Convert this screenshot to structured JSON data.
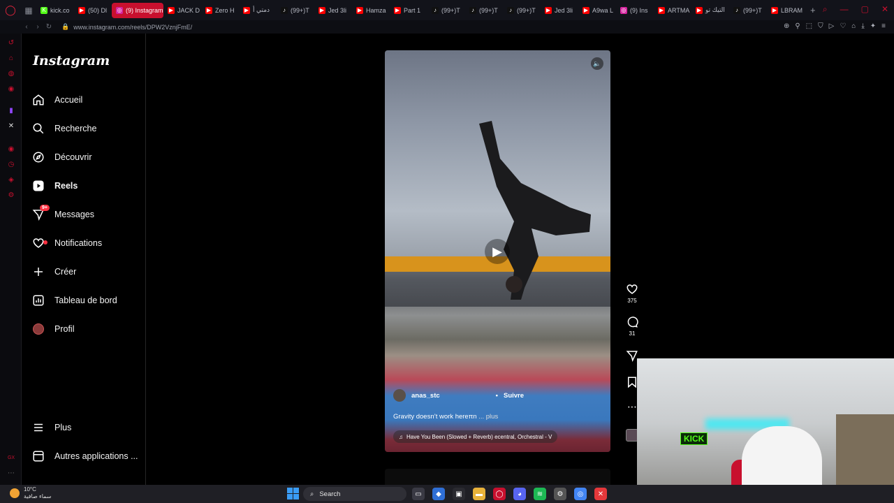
{
  "browser": {
    "tabs": [
      {
        "label": "kick.co",
        "favicon_color": "#53fc18",
        "favicon_glyph": "K"
      },
      {
        "label": "(50) Dl",
        "favicon_color": "#ff0000",
        "favicon_glyph": "▶"
      },
      {
        "label": "(9) Instagram",
        "favicon_color": "#d6249f",
        "favicon_glyph": "◎",
        "active": true
      },
      {
        "label": "JACK D",
        "favicon_color": "#ff0000",
        "favicon_glyph": "▶"
      },
      {
        "label": "Zero H",
        "favicon_color": "#ff0000",
        "favicon_glyph": "▶"
      },
      {
        "label": "دمتي أ",
        "favicon_color": "#ff0000",
        "favicon_glyph": "▶"
      },
      {
        "label": "(99+)T",
        "favicon_color": "#111111",
        "favicon_glyph": "♪"
      },
      {
        "label": "Jed 3li",
        "favicon_color": "#ff0000",
        "favicon_glyph": "▶"
      },
      {
        "label": "Hamza",
        "favicon_color": "#ff0000",
        "favicon_glyph": "▶"
      },
      {
        "label": "Part 1",
        "favicon_color": "#ff0000",
        "favicon_glyph": "▶"
      },
      {
        "label": "(99+)T",
        "favicon_color": "#111111",
        "favicon_glyph": "♪"
      },
      {
        "label": "(99+)T",
        "favicon_color": "#111111",
        "favicon_glyph": "♪"
      },
      {
        "label": "(99+)T",
        "favicon_color": "#111111",
        "favicon_glyph": "♪"
      },
      {
        "label": "Jed 3li",
        "favicon_color": "#ff0000",
        "favicon_glyph": "▶"
      },
      {
        "label": "A9wa L",
        "favicon_color": "#ff0000",
        "favicon_glyph": "▶"
      },
      {
        "label": "(9) Ins",
        "favicon_color": "#d6249f",
        "favicon_glyph": "◎"
      },
      {
        "label": "ARTMA",
        "favicon_color": "#ff0000",
        "favicon_glyph": "▶"
      },
      {
        "label": "التيك تو",
        "favicon_color": "#ff0000",
        "favicon_glyph": "▶"
      },
      {
        "label": "(99+)T",
        "favicon_color": "#111111",
        "favicon_glyph": "♪"
      },
      {
        "label": "LBRAM",
        "favicon_color": "#ff0000",
        "favicon_glyph": "▶"
      }
    ],
    "new_tab_glyph": "+",
    "url": "www.instagram.com/reels/DPW2VznjFmE/",
    "accent": "#c8102e"
  },
  "instagram": {
    "logo": "Instagram",
    "nav": [
      {
        "label": "Accueil",
        "icon": "home-icon"
      },
      {
        "label": "Recherche",
        "icon": "search-icon"
      },
      {
        "label": "Découvrir",
        "icon": "compass-icon"
      },
      {
        "label": "Reels",
        "icon": "reels-icon",
        "active": true
      },
      {
        "label": "Messages",
        "icon": "messenger-icon",
        "badge": "9+"
      },
      {
        "label": "Notifications",
        "icon": "heart-icon"
      },
      {
        "label": "Créer",
        "icon": "plus-icon"
      },
      {
        "label": "Tableau de bord",
        "icon": "dashboard-icon"
      },
      {
        "label": "Profil",
        "icon": "avatar-icon"
      }
    ],
    "nav_bottom": [
      {
        "label": "Plus",
        "icon": "menu-icon"
      },
      {
        "label": "Autres applications ...",
        "icon": "apps-icon"
      }
    ]
  },
  "reel": {
    "author": "anas_stc",
    "follow_label": "Suivre",
    "caption": "Gravity doesn’t work hereπn",
    "caption_more": "... plus",
    "music": "Have You Been (Slowed + Reverb)  ecentral, Orchestral - V",
    "likes": "375",
    "comments": "31"
  },
  "taskbar": {
    "temperature": "10°C",
    "weather_desc": "سماء صافية",
    "search_placeholder": "Search"
  },
  "webcam": {
    "sign_text": "KICK"
  }
}
